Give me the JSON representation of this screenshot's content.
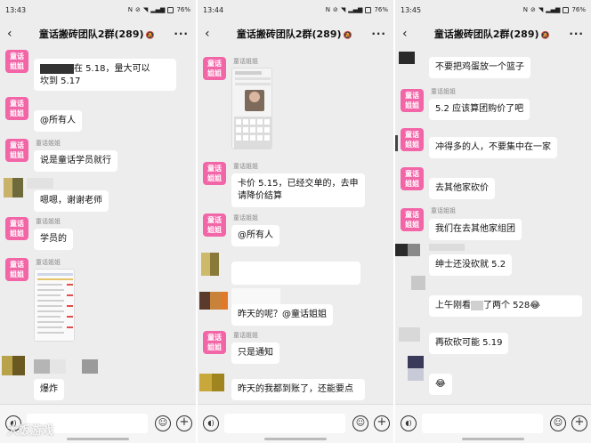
{
  "common": {
    "battery": "76%",
    "chat_title": "童话搬砖团队2群(289)",
    "sender": "童话姐姐",
    "avatar_text": "童话姐姐",
    "back": "‹",
    "more": "···",
    "watermark": "大饭游戏"
  },
  "panels": [
    {
      "time": "13:43",
      "messages": [
        {
          "text_a": "在 5.18，量大可以",
          "text_b": "坎到 5.17"
        },
        {
          "text": "@所有人"
        },
        {
          "text": "说是童话学员就行"
        },
        {
          "text": "嗯嗯，谢谢老师"
        },
        {
          "text": "学员的"
        },
        {
          "text": "爆炸"
        }
      ]
    },
    {
      "time": "13:44",
      "messages": [
        {
          "text_a": "卡价 5.15，已经交单的，去申",
          "text_b": "请降价结算"
        },
        {
          "text": "@所有人"
        },
        {
          "text": "昨天的呢？@童话姐姐"
        },
        {
          "text": "只是通知"
        },
        {
          "text": "昨天的我都到账了，还能要点"
        }
      ]
    },
    {
      "time": "13:45",
      "messages": [
        {
          "text": "不要把鸡蛋放一个篮子"
        },
        {
          "text": "5.2 应该算团购价了吧"
        },
        {
          "text": "冲得多的人，不要集中在一家"
        },
        {
          "text": "去其他家砍价"
        },
        {
          "text": "我们在去其他家组团"
        },
        {
          "text": "绅士还没砍就 5.2"
        },
        {
          "text_a": "上午刚看",
          "text_b": "了两个 528😂"
        },
        {
          "text": "再砍砍可能 5.19"
        },
        {
          "text": "😂"
        }
      ]
    }
  ]
}
